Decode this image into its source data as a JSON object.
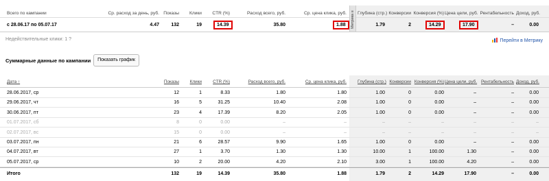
{
  "summary": {
    "headers": [
      "Всего по кампании",
      "Ср. расход за день, руб.",
      "Показы",
      "Клики",
      "CTR (%)",
      "Расход всего, руб.",
      "Ср. цена клика, руб.",
      "Глубина (стр.)",
      "Конверсии",
      "Конверсия (%)",
      "Цена цели, руб.",
      "Рентабельность",
      "Доход, руб."
    ],
    "row": [
      "с 28.06.17 по 05.07.17",
      "4.47",
      "132",
      "19",
      "14.39",
      "35.80",
      "1.88",
      "1.79",
      "2",
      "14.29",
      "17.90",
      "–",
      "0.00"
    ],
    "metrika_tab": "Метрика ≡",
    "indirect_clicks": "Недействительные клики: 1",
    "indirect_help": "?",
    "metrika_link": "Перейти в Метрику"
  },
  "daily": {
    "title": "Суммарные данные по кампании",
    "graph_button": "Показать график",
    "headers": [
      "Дата ↑",
      "Показы",
      "Клики",
      "CTR (%)",
      "Расход всего, руб.",
      "Ср. цена клика, руб.",
      "Глубина (стр.)",
      "Конверсии",
      "Конверсия (%)",
      "Цена цели, руб.",
      "Рентабельность",
      "Доход, руб."
    ],
    "rows": [
      [
        "28.06.2017, ср",
        "12",
        "1",
        "8.33",
        "1.80",
        "1.80",
        "1.00",
        "0",
        "0.00",
        "–",
        "–",
        "0.00"
      ],
      [
        "29.06.2017, чт",
        "16",
        "5",
        "31.25",
        "10.40",
        "2.08",
        "1.00",
        "0",
        "0.00",
        "–",
        "–",
        "0.00"
      ],
      [
        "30.06.2017, пт",
        "23",
        "4",
        "17.39",
        "8.20",
        "2.05",
        "1.00",
        "0",
        "0.00",
        "–",
        "–",
        "0.00"
      ],
      [
        "01.07.2017, сб",
        "8",
        "0",
        "0.00",
        "–",
        "–",
        "–",
        "–",
        "–",
        "–",
        "–",
        "–"
      ],
      [
        "02.07.2017, вс",
        "15",
        "0",
        "0.00",
        "–",
        "–",
        "–",
        "–",
        "–",
        "–",
        "–",
        "–"
      ],
      [
        "03.07.2017, пн",
        "21",
        "6",
        "28.57",
        "9.90",
        "1.65",
        "1.00",
        "0",
        "0.00",
        "–",
        "–",
        "0.00"
      ],
      [
        "04.07.2017, вт",
        "27",
        "1",
        "3.70",
        "1.30",
        "1.30",
        "10.00",
        "1",
        "100.00",
        "1.30",
        "–",
        "0.00"
      ],
      [
        "05.07.2017, ср",
        "10",
        "2",
        "20.00",
        "4.20",
        "2.10",
        "3.00",
        "1",
        "100.00",
        "4.20",
        "–",
        "0.00"
      ]
    ],
    "weekend_rows": [
      3,
      4
    ],
    "total": [
      "Итого",
      "132",
      "19",
      "14.39",
      "35.80",
      "1.88",
      "1.79",
      "2",
      "14.29",
      "17.90",
      "–",
      "0.00"
    ]
  },
  "colors": {
    "highlight_box": "#e00000",
    "metrika_band": "#f0f0f0",
    "link": "#2255aa"
  },
  "icons": {
    "metrika": "metrika-bars-icon"
  }
}
